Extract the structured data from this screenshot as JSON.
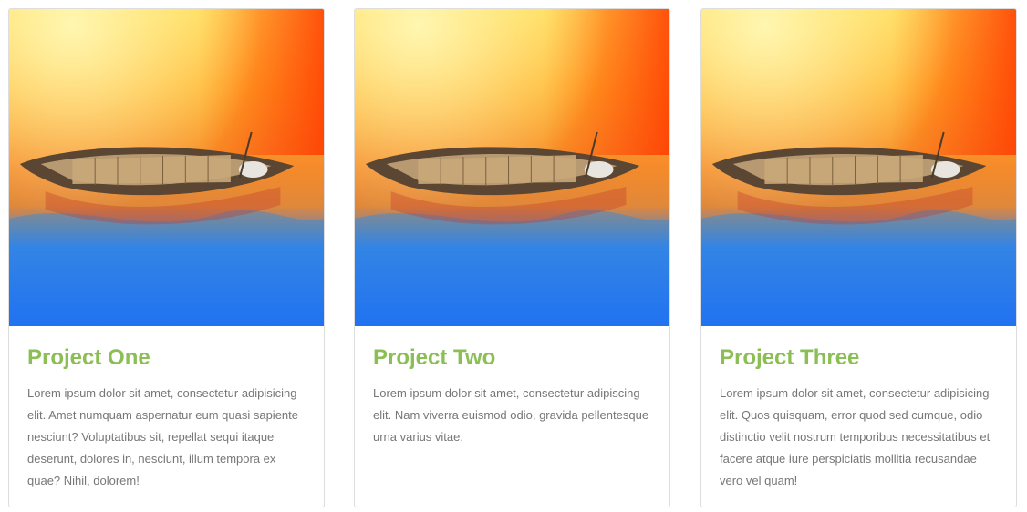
{
  "projects": [
    {
      "title": "Project One",
      "description": "Lorem ipsum dolor sit amet, consectetur adipisicing elit. Amet numquam aspernatur eum quasi sapiente nesciunt? Voluptatibus sit, repellat sequi itaque deserunt, dolores in, nesciunt, illum tempora ex quae? Nihil, dolorem!",
      "image": "boat-on-colorful-water"
    },
    {
      "title": "Project Two",
      "description": "Lorem ipsum dolor sit amet, consectetur adipiscing elit. Nam viverra euismod odio, gravida pellentesque urna varius vitae.",
      "image": "boat-on-colorful-water"
    },
    {
      "title": "Project Three",
      "description": "Lorem ipsum dolor sit amet, consectetur adipisicing elit. Quos quisquam, error quod sed cumque, odio distinctio velit nostrum temporibus necessitatibus et facere atque iure perspiciatis mollitia recusandae vero vel quam!",
      "image": "boat-on-colorful-water"
    }
  ],
  "colors": {
    "title": "#8bbf55",
    "text": "#777777",
    "border": "#dddddd"
  }
}
